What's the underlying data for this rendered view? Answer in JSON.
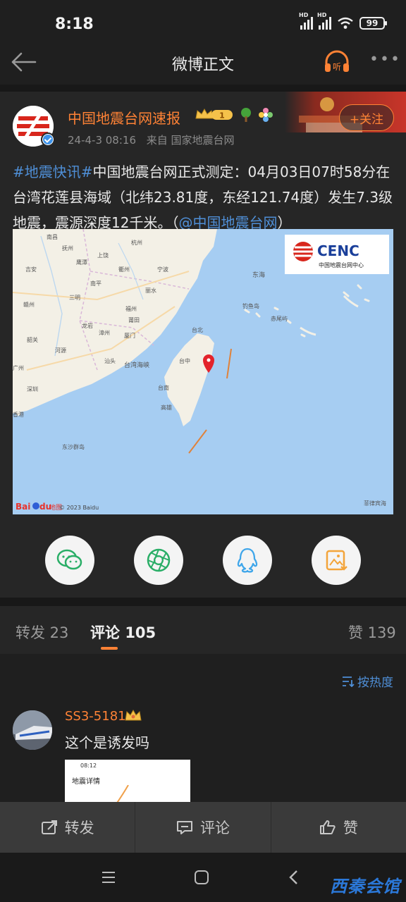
{
  "status_bar": {
    "time": "8:18",
    "battery": "99",
    "signal_label": "HD"
  },
  "nav": {
    "title": "微博正文",
    "listen_icon_text": "听"
  },
  "post": {
    "username": "中国地震台网速报",
    "level_badge": "1",
    "date": "24-4-3 08:16",
    "source": "来自 国家地震台网",
    "follow_label": "+关注",
    "text_tag": "#地震快讯#",
    "text_body": "中国地震台网正式测定：04月03日07时58分在台湾花莲县海域（北纬23.81度，东经121.74度）发生7.3级地震，震源深度12千米。（",
    "text_mention": "@中国地震台网",
    "text_end": "）"
  },
  "map": {
    "logo_text": "CENC",
    "logo_sub": "中国地震台网中心",
    "labels": {
      "nanchang": "南昌",
      "hangzhou": "杭州",
      "ningbo": "宁波",
      "wenzhou": "温州",
      "fuzhou": "福州",
      "putian": "莆田",
      "xiamen": "厦门",
      "guangzhou": "广州",
      "shenzhen": "深圳",
      "taibei": "台北",
      "taizhong": "台中",
      "tainan": "台南",
      "gaoxiong": "高雄",
      "hongkong": "香港",
      "donghai": "东海",
      "taiwan_strait": "台湾海峡",
      "ji_an": "吉安",
      "ganzhou": "赣州",
      "shantou": "汕头",
      "zhangzhou": "漳州",
      "heyuan": "河源",
      "shaoguan": "韶关",
      "longyan": "龙岩",
      "sanming": "三明",
      "nanping": "南平",
      "lishui": "丽水",
      "quzhou": "衢州",
      "fuzhou_jx": "抚州",
      "shangrao": "上饶",
      "yingtan": "鹰潭",
      "diaoyu": "钓鱼岛",
      "chiwei": "赤尾屿",
      "dongsha": "东沙群岛",
      "baidu": "Bai",
      "baidu_du": "du",
      "map_word": "地图",
      "copyright": "© 2023 Baidu",
      "feilvbin": "菲律宾海"
    }
  },
  "share": {
    "items": [
      {
        "name": "wechat",
        "color": "#2aae67"
      },
      {
        "name": "moments",
        "color": "#2aae67"
      },
      {
        "name": "qq",
        "color": "#3fa6ea"
      },
      {
        "name": "save-image",
        "color": "#f3a43a"
      }
    ]
  },
  "tabs": {
    "repost": "转发 23",
    "comment_label": "评论",
    "comment_count": "105",
    "like": "赞 139"
  },
  "comments": {
    "sort_label": "按热度",
    "items": [
      {
        "user": "SS3-5181",
        "text": "这个是诱发吗",
        "image_time": "08:12",
        "image_title": "地震详情"
      }
    ]
  },
  "actions": {
    "repost": "转发",
    "comment": "评论",
    "like": "赞"
  },
  "watermark": "西秦会馆",
  "colors": {
    "accent": "#ff8235",
    "link": "#4f8fd7",
    "background": "#1f1f1f"
  }
}
